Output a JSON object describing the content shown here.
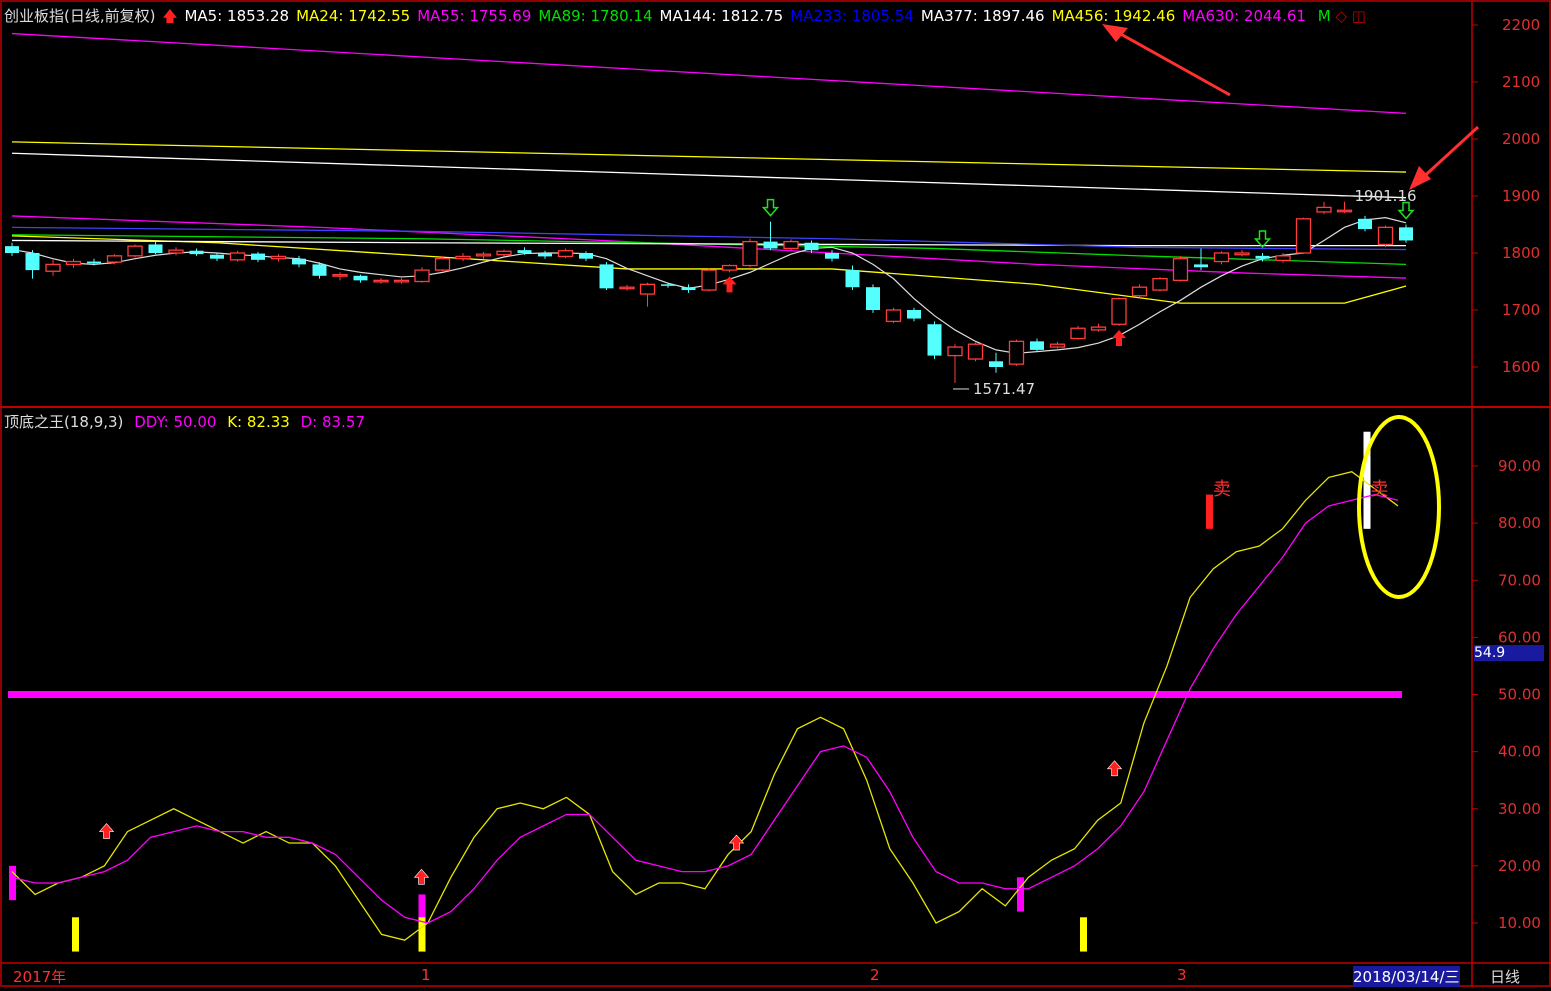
{
  "colors": {
    "up": "#ff3c3c",
    "down": "#54ffff",
    "frame": "#c00000",
    "K": "#e6e600",
    "D": "#ff00ff",
    "level": "#ff00ff",
    "annotation": "#ff3030",
    "highlight": "#ffff00"
  },
  "price_header": {
    "title": "创业板指(日线,前复权)",
    "ma": [
      {
        "text": "MA5: 1853.28",
        "color": "#ffffff"
      },
      {
        "text": "MA24: 1742.55",
        "color": "#ffff00"
      },
      {
        "text": "MA55: 1755.69",
        "color": "#ff00ff"
      },
      {
        "text": "MA89: 1780.14",
        "color": "#00e000"
      },
      {
        "text": "MA144: 1812.75",
        "color": "#ffffff"
      },
      {
        "text": "MA233: 1805.54",
        "color": "#0000ff"
      },
      {
        "text": "MA377: 1897.46",
        "color": "#ffffff"
      },
      {
        "text": "MA456: 1942.46",
        "color": "#ffff00"
      },
      {
        "text": "MA630: 2044.61",
        "color": "#ff00ff"
      }
    ],
    "tail_label": "M"
  },
  "indicator_header": {
    "title": "顶底之王(18,9,3)",
    "ddy": "DDY: 50.00",
    "k": "K: 82.33",
    "d": "D: 83.57"
  },
  "time_axis": {
    "labels": [
      "2017年",
      "1",
      "2",
      "3"
    ],
    "current_date": "2018/03/14/三",
    "period": "日线"
  },
  "chart_data": [
    {
      "type": "candlestick",
      "y_ticks": [
        1600,
        1700,
        1800,
        1900,
        2000,
        2100,
        2200
      ],
      "ylim": [
        1540,
        2230
      ],
      "candles": [
        [
          1812,
          1800,
          1818,
          1795
        ],
        [
          1800,
          1770,
          1805,
          1755
        ],
        [
          1768,
          1780,
          1788,
          1760
        ],
        [
          1780,
          1785,
          1790,
          1774
        ],
        [
          1785,
          1782,
          1790,
          1778
        ],
        [
          1784,
          1795,
          1798,
          1780
        ],
        [
          1795,
          1812,
          1815,
          1792
        ],
        [
          1815,
          1800,
          1820,
          1798
        ],
        [
          1800,
          1805,
          1810,
          1796
        ],
        [
          1804,
          1798,
          1808,
          1795
        ],
        [
          1797,
          1790,
          1800,
          1786
        ],
        [
          1788,
          1800,
          1804,
          1785
        ],
        [
          1799,
          1788,
          1802,
          1784
        ],
        [
          1790,
          1794,
          1798,
          1785
        ],
        [
          1790,
          1780,
          1795,
          1775
        ],
        [
          1780,
          1760,
          1784,
          1755
        ],
        [
          1760,
          1762,
          1766,
          1752
        ],
        [
          1760,
          1752,
          1762,
          1748
        ],
        [
          1750,
          1752,
          1756,
          1746
        ],
        [
          1750,
          1752,
          1756,
          1746
        ],
        [
          1750,
          1770,
          1775,
          1748
        ],
        [
          1770,
          1790,
          1795,
          1768
        ],
        [
          1790,
          1794,
          1800,
          1786
        ],
        [
          1795,
          1798,
          1802,
          1790
        ],
        [
          1797,
          1803,
          1806,
          1794
        ],
        [
          1805,
          1800,
          1810,
          1797
        ],
        [
          1800,
          1794,
          1804,
          1790
        ],
        [
          1794,
          1804,
          1808,
          1791
        ],
        [
          1800,
          1790,
          1803,
          1786
        ],
        [
          1780,
          1738,
          1784,
          1735
        ],
        [
          1738,
          1740,
          1744,
          1734
        ],
        [
          1728,
          1745,
          1748,
          1706
        ],
        [
          1745,
          1743,
          1748,
          1739
        ],
        [
          1740,
          1735,
          1745,
          1730
        ],
        [
          1735,
          1770,
          1773,
          1733
        ],
        [
          1770,
          1778,
          1780,
          1766
        ],
        [
          1778,
          1820,
          1825,
          1775
        ],
        [
          1820,
          1808,
          1855,
          1805
        ],
        [
          1808,
          1820,
          1824,
          1805
        ],
        [
          1818,
          1805,
          1822,
          1800
        ],
        [
          1800,
          1790,
          1805,
          1785
        ],
        [
          1770,
          1740,
          1778,
          1735
        ],
        [
          1740,
          1700,
          1745,
          1695
        ],
        [
          1680,
          1700,
          1704,
          1677
        ],
        [
          1700,
          1685,
          1704,
          1680
        ],
        [
          1675,
          1620,
          1680,
          1614
        ],
        [
          1620,
          1635,
          1640,
          1572
        ],
        [
          1614,
          1640,
          1643,
          1610
        ],
        [
          1610,
          1600,
          1625,
          1590
        ],
        [
          1605,
          1645,
          1648,
          1602
        ],
        [
          1645,
          1630,
          1650,
          1627
        ],
        [
          1635,
          1640,
          1644,
          1632
        ],
        [
          1650,
          1668,
          1672,
          1648
        ],
        [
          1665,
          1670,
          1676,
          1662
        ],
        [
          1675,
          1720,
          1722,
          1672
        ],
        [
          1725,
          1740,
          1745,
          1722
        ],
        [
          1735,
          1755,
          1758,
          1733
        ],
        [
          1752,
          1790,
          1795,
          1750
        ],
        [
          1780,
          1775,
          1808,
          1770
        ],
        [
          1785,
          1800,
          1803,
          1780
        ],
        [
          1797,
          1800,
          1805,
          1794
        ],
        [
          1795,
          1790,
          1800,
          1785
        ],
        [
          1787,
          1795,
          1800,
          1783
        ],
        [
          1800,
          1860,
          1862,
          1798
        ],
        [
          1872,
          1880,
          1890,
          1868
        ],
        [
          1875,
          1875,
          1890,
          1870
        ],
        [
          1860,
          1842,
          1865,
          1838
        ],
        [
          1815,
          1845,
          1848,
          1810
        ],
        [
          1845,
          1822,
          1850,
          1818
        ]
      ],
      "ma5_close_line": [
        1806,
        1800,
        1790,
        1782,
        1780,
        1783,
        1790,
        1796,
        1800,
        1802,
        1800,
        1797,
        1795,
        1792,
        1790,
        1782,
        1772,
        1766,
        1762,
        1758,
        1760,
        1766,
        1774,
        1784,
        1793,
        1799,
        1800,
        1800,
        1799,
        1790,
        1773,
        1760,
        1747,
        1738,
        1744,
        1754,
        1766,
        1782,
        1798,
        1808,
        1810,
        1800,
        1780,
        1755,
        1720,
        1690,
        1665,
        1645,
        1630,
        1624,
        1627,
        1630,
        1634,
        1642,
        1655,
        1675,
        1697,
        1717,
        1740,
        1760,
        1777,
        1790,
        1796,
        1800,
        1822,
        1845,
        1858,
        1862,
        1853
      ],
      "ma_lines": [
        {
          "name": "MA24",
          "color": "#ffff00",
          "points": [
            [
              0,
              1830
            ],
            [
              10,
              1818
            ],
            [
              20,
              1795
            ],
            [
              30,
              1772
            ],
            [
              40,
              1772
            ],
            [
              50,
              1745
            ],
            [
              57,
              1712
            ],
            [
              65,
              1712
            ],
            [
              68,
              1742
            ]
          ]
        },
        {
          "name": "MA55",
          "color": "#ff00ff",
          "points": [
            [
              0,
              1865
            ],
            [
              15,
              1845
            ],
            [
              30,
              1820
            ],
            [
              40,
              1800
            ],
            [
              50,
              1780
            ],
            [
              60,
              1765
            ],
            [
              68,
              1756
            ]
          ]
        },
        {
          "name": "MA89",
          "color": "#00e000",
          "points": [
            [
              0,
              1832
            ],
            [
              20,
              1825
            ],
            [
              35,
              1815
            ],
            [
              45,
              1808
            ],
            [
              55,
              1795
            ],
            [
              68,
              1780
            ]
          ]
        },
        {
          "name": "MA144",
          "color": "#ffffff",
          "points": [
            [
              0,
              1822
            ],
            [
              20,
              1818
            ],
            [
              40,
              1815
            ],
            [
              55,
              1813
            ],
            [
              68,
              1813
            ]
          ]
        },
        {
          "name": "MA233",
          "color": "#4040ff",
          "points": [
            [
              0,
              1845
            ],
            [
              20,
              1838
            ],
            [
              40,
              1825
            ],
            [
              55,
              1810
            ],
            [
              68,
              1806
            ]
          ]
        },
        {
          "name": "MA377",
          "color": "#ffffff",
          "points": [
            [
              0,
              1975
            ],
            [
              68,
              1897
            ]
          ]
        },
        {
          "name": "MA456",
          "color": "#ffff00",
          "points": [
            [
              0,
              1995
            ],
            [
              68,
              1942
            ]
          ]
        },
        {
          "name": "MA630",
          "color": "#ff00ff",
          "points": [
            [
              0,
              2185
            ],
            [
              68,
              2045
            ]
          ]
        }
      ],
      "annotations": [
        {
          "text": "1571.47",
          "bar": 46,
          "value": 1572,
          "side": "low"
        },
        {
          "text": "1901.16",
          "bar": 65,
          "value": 1900,
          "side": "high"
        }
      ],
      "buy_arrows": [
        35,
        54
      ],
      "sell_arrows": [
        37,
        61,
        68
      ]
    },
    {
      "type": "line",
      "title": "顶底之王(18,9,3)",
      "y_ticks": [
        10,
        20,
        30,
        40,
        50,
        60,
        70,
        80,
        90
      ],
      "ylim": [
        3,
        99
      ],
      "level": 50,
      "current_value_label": "54.9",
      "series": [
        {
          "name": "K",
          "values": [
            19,
            15,
            17,
            18,
            20,
            26,
            28,
            30,
            28,
            26,
            24,
            26,
            24,
            24,
            20,
            14,
            8,
            7,
            10,
            18,
            25,
            30,
            31,
            30,
            32,
            29,
            19,
            15,
            17,
            17,
            16,
            22,
            26,
            36,
            44,
            46,
            44,
            35,
            23,
            17,
            10,
            12,
            16,
            13,
            18,
            21,
            23,
            28,
            31,
            45,
            55,
            67,
            72,
            75,
            76,
            79,
            84,
            88,
            89,
            86,
            83
          ]
        },
        {
          "name": "D",
          "values": [
            18,
            17,
            17,
            18,
            19,
            21,
            25,
            26,
            27,
            26,
            26,
            25,
            25,
            24,
            22,
            18,
            14,
            11,
            10,
            12,
            16,
            21,
            25,
            27,
            29,
            29,
            25,
            21,
            20,
            19,
            19,
            20,
            22,
            28,
            34,
            40,
            41,
            39,
            33,
            25,
            19,
            17,
            17,
            16,
            16,
            18,
            20,
            23,
            27,
            33,
            42,
            51,
            58,
            64,
            69,
            74,
            80,
            83,
            84,
            85,
            84
          ]
        }
      ],
      "bars": [
        {
          "bar": 0,
          "from": 14,
          "to": 20,
          "color": "#ff00ff"
        },
        {
          "bar": 2,
          "from": 5,
          "to": 11,
          "color": "#ffff00"
        },
        {
          "bar": 13,
          "from": 5,
          "to": 15,
          "color": "#ff00ff"
        },
        {
          "bar": 13,
          "from": 5,
          "to": 11,
          "color": "#ffff00"
        },
        {
          "bar": 32,
          "from": 12,
          "to": 18,
          "color": "#ff00ff"
        },
        {
          "bar": 34,
          "from": 5,
          "to": 11,
          "color": "#ffff00"
        },
        {
          "bar": 38,
          "from": 79,
          "to": 85,
          "color": "#ff2020"
        },
        {
          "bar": 43,
          "from": 79,
          "to": 96,
          "color": "#ffffff"
        }
      ],
      "markers": [
        {
          "bar": 3,
          "value": 26,
          "text": "↑"
        },
        {
          "bar": 13,
          "value": 18,
          "text": "↑"
        },
        {
          "bar": 23,
          "value": 24,
          "text": "↑"
        },
        {
          "bar": 35,
          "value": 37,
          "text": "↑"
        },
        {
          "bar": 38,
          "value": 86,
          "text": "卖"
        },
        {
          "bar": 43,
          "value": 86,
          "text": "卖"
        }
      ]
    }
  ]
}
